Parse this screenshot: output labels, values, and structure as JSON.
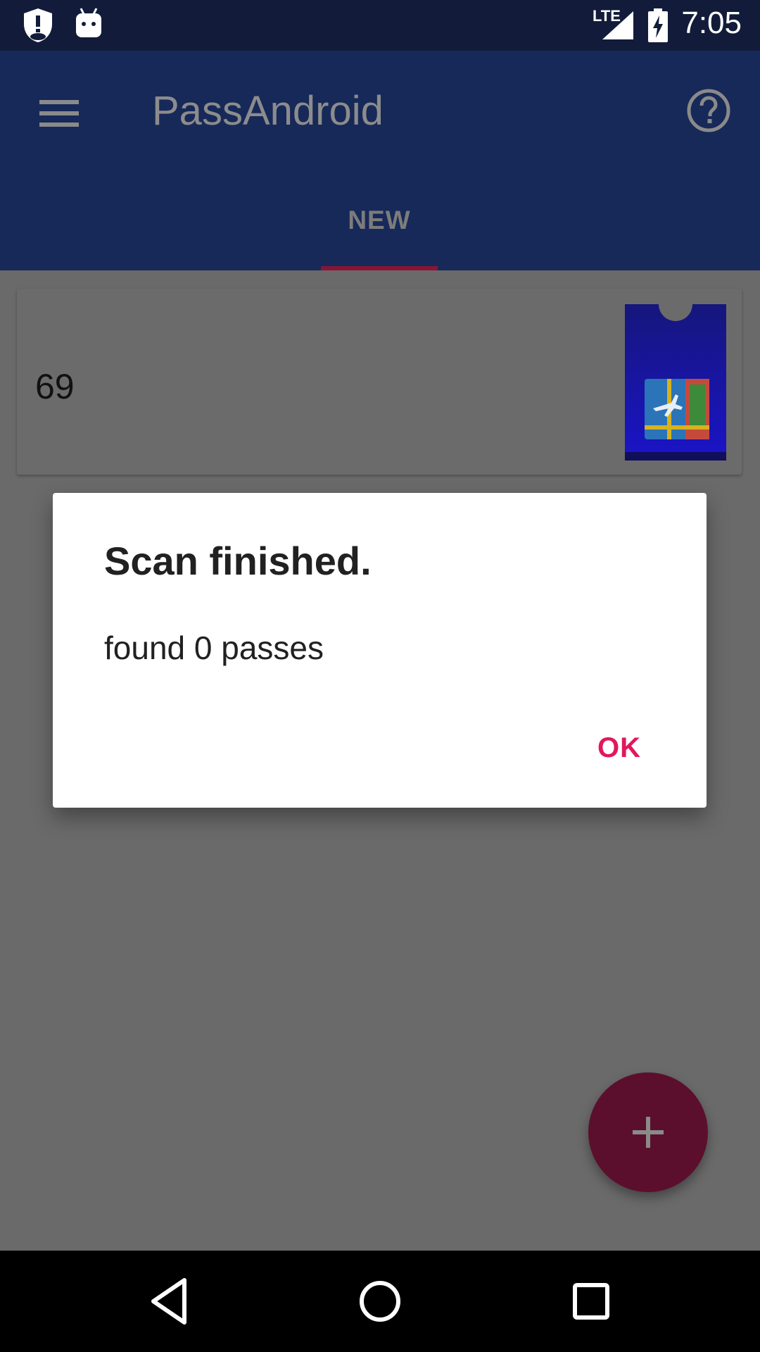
{
  "status_bar": {
    "time": "7:05",
    "network": "LTE",
    "icons": [
      "shield-icon",
      "android-icon",
      "signal-icon",
      "battery-charging-icon"
    ]
  },
  "app_bar": {
    "title": "PassAndroid",
    "menu_icon": "hamburger-menu-icon",
    "help_icon": "help-circle-icon"
  },
  "tabs": [
    {
      "label": "NEW",
      "selected": true
    }
  ],
  "passes": [
    {
      "number": "69",
      "thumbnail_icon": "boarding-pass-icon"
    }
  ],
  "dialog": {
    "title": "Scan finished.",
    "message": "found 0 passes",
    "ok_label": "OK"
  },
  "fab": {
    "icon": "plus-icon"
  },
  "nav_bar": {
    "icons": [
      "back-icon",
      "home-icon",
      "recents-icon"
    ]
  },
  "colors": {
    "status_bar": "#121c3a",
    "app_bar": "#172959",
    "accent": "#e2175c",
    "scrim_background": "#6a6a6a",
    "fab": "#5c0f2c",
    "dialog_background": "#ffffff"
  }
}
